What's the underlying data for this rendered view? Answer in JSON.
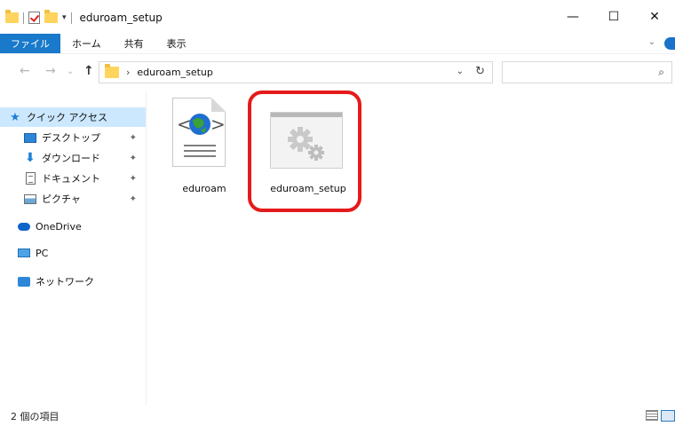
{
  "window": {
    "title": "eduroam_setup",
    "controls": {
      "minimize": "—",
      "maximize": "☐",
      "close": "✕"
    }
  },
  "quick_access_toolbar": {
    "dropdown": "▾"
  },
  "ribbon": {
    "tabs": [
      {
        "label": "ファイル",
        "active": true
      },
      {
        "label": "ホーム"
      },
      {
        "label": "共有"
      },
      {
        "label": "表示"
      }
    ],
    "collapse": "⌄"
  },
  "address": {
    "back": "←",
    "forward": "→",
    "recent": "⌄",
    "up": "↑",
    "breadcrumb_sep": "›",
    "path": "eduroam_setup",
    "dropdown": "⌄",
    "refresh": "↻",
    "search_placeholder": "",
    "search_icon": "⌕"
  },
  "nav": {
    "items": [
      {
        "label": "クイック アクセス",
        "icon": "star-icon",
        "selected": true
      },
      {
        "label": "デスクトップ",
        "icon": "desktop-icon",
        "pinned": true
      },
      {
        "label": "ダウンロード",
        "icon": "download-icon",
        "pinned": true
      },
      {
        "label": "ドキュメント",
        "icon": "document-icon",
        "pinned": true
      },
      {
        "label": "ピクチャ",
        "icon": "pictures-icon",
        "pinned": true
      },
      {
        "label": "OneDrive",
        "icon": "cloud-icon"
      },
      {
        "label": "PC",
        "icon": "pc-icon"
      },
      {
        "label": "ネットワーク",
        "icon": "network-icon"
      }
    ],
    "pin_glyph": "📌"
  },
  "files": [
    {
      "name": "eduroam",
      "type": "html-document",
      "icon": "html-document-icon"
    },
    {
      "name": "eduroam_setup",
      "type": "application",
      "icon": "gears-application-icon",
      "highlighted": true
    }
  ],
  "status": {
    "item_count": "2 個の項目"
  },
  "colors": {
    "file_tab": "#1979ca",
    "selected_nav": "#cce8ff",
    "highlight_ring": "#e51a1a",
    "folder": "#ffd45e"
  }
}
